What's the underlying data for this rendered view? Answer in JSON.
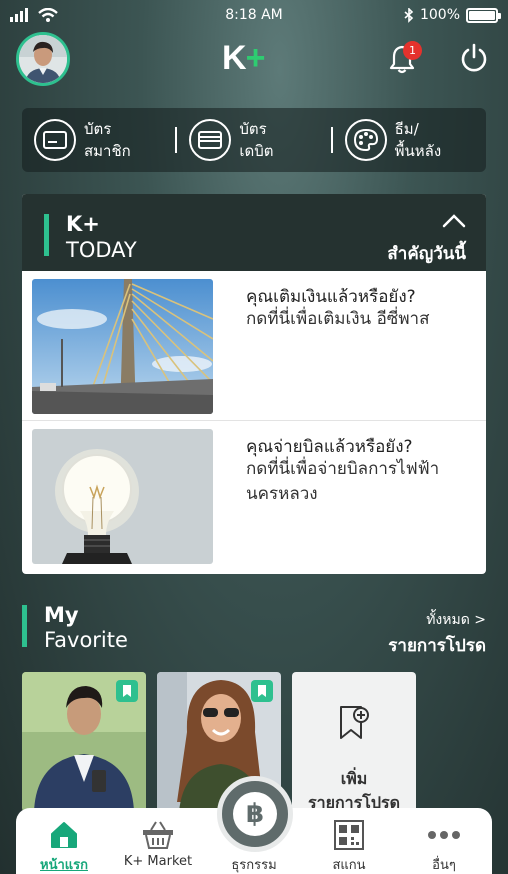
{
  "status_bar": {
    "time": "8:18 AM",
    "battery": "100%",
    "battery_level": 1.0
  },
  "header": {
    "logo_k": "K",
    "logo_plus": "+",
    "notification_count": "1"
  },
  "quick_actions": [
    {
      "line1": "บัตร",
      "line2": "สมาชิก",
      "icon": "member-card-icon"
    },
    {
      "line1": "บัตร",
      "line2": "เดบิต",
      "icon": "debit-card-icon"
    },
    {
      "line1": "ธีม/",
      "line2": "พื้นหลัง",
      "icon": "palette-icon"
    }
  ],
  "today": {
    "title_line1": "K+",
    "title_line2": "TODAY",
    "subtitle": "สำคัญวันนี้",
    "items": [
      {
        "title": "คุณเติมเงินแล้วหรือยัง?",
        "description": "กดที่นี่เพื่อเติมเงิน อีซี่พาส"
      },
      {
        "title": "คุณจ่ายบิลแล้วหรือยัง?",
        "description": "กดที่นี่เพื่อจ่ายบิลการไฟฟ้านครหลวง"
      }
    ]
  },
  "favorite": {
    "title_line1": "My",
    "title_line2": "Favorite",
    "view_all": "ทั้งหมด >",
    "subtitle": "รายการโปรด",
    "add_label_line1": "เพิ่ม",
    "add_label_line2": "รายการโปรด"
  },
  "tabs": [
    {
      "label": "หน้าแรก",
      "icon": "home-icon",
      "active": true
    },
    {
      "label": "K+ Market",
      "icon": "basket-icon",
      "active": false
    },
    {
      "label": "ธุรกรรม",
      "icon": "baht-icon",
      "active": false
    },
    {
      "label": "สแกน",
      "icon": "qr-scan-icon",
      "active": false
    },
    {
      "label": "อื่นๆ",
      "icon": "more-icon",
      "active": false
    }
  ],
  "colors": {
    "accent": "#2ec08f",
    "badge": "#e5322d",
    "header_bg": "#253230"
  }
}
